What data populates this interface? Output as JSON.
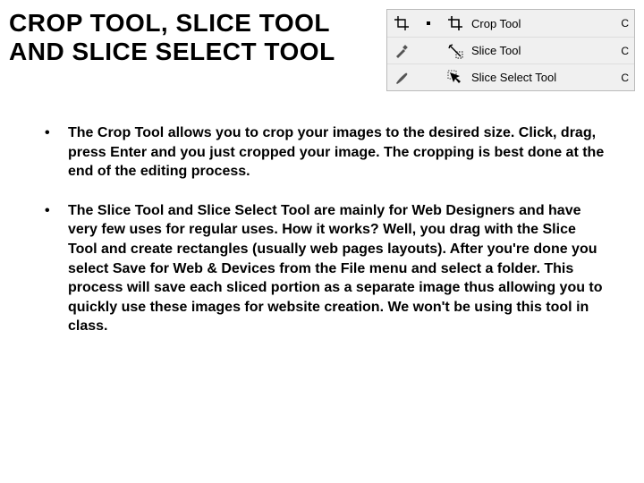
{
  "title": "CROP TOOL, SLICE TOOL AND SLICE SELECT TOOL",
  "tool_panel": {
    "rows": [
      {
        "label": "Crop Tool",
        "shortcut": "C"
      },
      {
        "label": "Slice Tool",
        "shortcut": "C"
      },
      {
        "label": "Slice Select Tool",
        "shortcut": "C"
      }
    ]
  },
  "bullets": [
    "The Crop Tool allows you to crop your images to the desired size. Click, drag, press Enter and you just cropped your image. The cropping is best done at the end of the editing process.",
    "The Slice Tool and Slice Select Tool are mainly for Web Designers and have very few uses for regular uses. How it works? Well, you drag with the Slice Tool and create rectangles (usually web pages layouts). After you're done you select Save for Web & Devices from the File menu and select a folder. This process will save each sliced portion as a separate image thus allowing you to quickly use these images for website creation. We won't be using this tool in class."
  ]
}
